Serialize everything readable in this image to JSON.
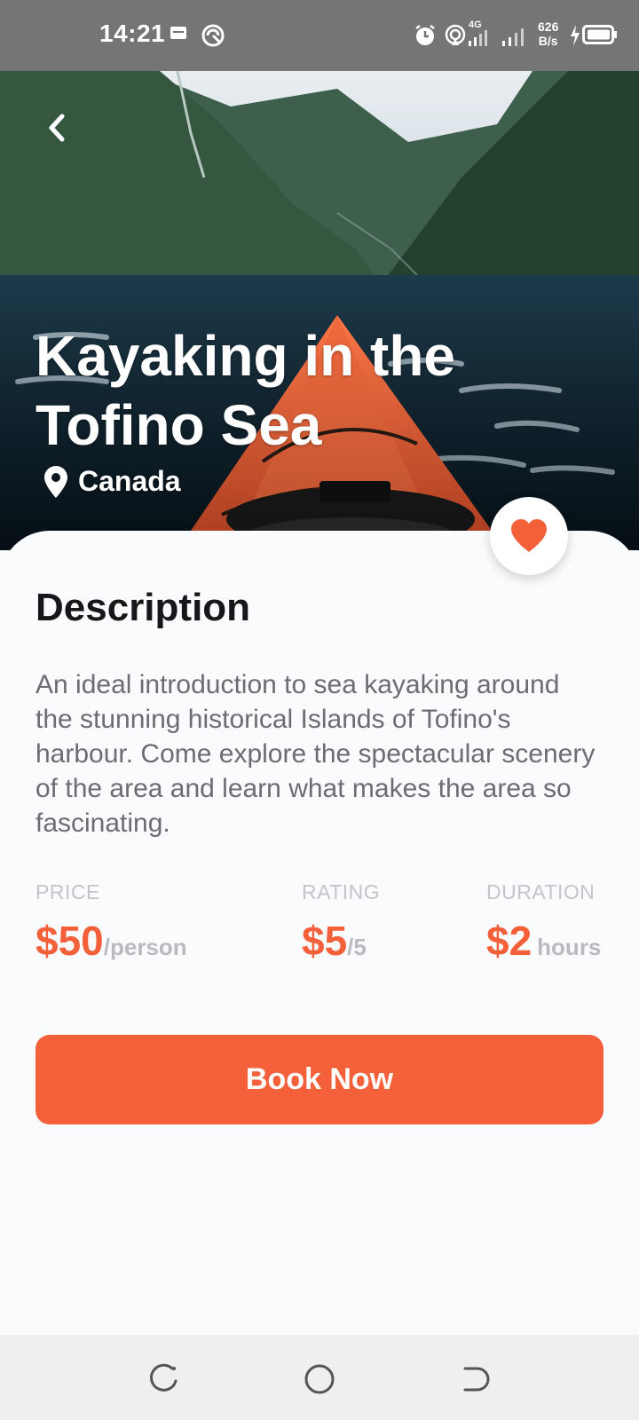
{
  "status_bar": {
    "time": "14:21",
    "network_speed_value": "626",
    "network_speed_unit": "B/s",
    "network_type": "4G",
    "icons": [
      "message-icon",
      "vpn-icon",
      "alarm-icon",
      "hotspot-icon",
      "signal-icon",
      "signal-icon",
      "charging-icon",
      "battery-icon"
    ]
  },
  "hero": {
    "title": "Kayaking in the Tofino Sea",
    "location": "Canada"
  },
  "content": {
    "description_heading": "Description",
    "description_text": "An ideal introduction to sea kayaking around the stunning historical Islands of Tofino's harbour. Come explore the spectacular scenery of the area and learn what makes the area so fascinating.",
    "stats": [
      {
        "label": "PRICE",
        "value": "$50",
        "unit": "/person"
      },
      {
        "label": "RATING",
        "value": "$5",
        "unit": "/5"
      },
      {
        "label": "DURATION",
        "value": "$2",
        "unit": "hours"
      }
    ],
    "book_button_label": "Book Now"
  },
  "colors": {
    "accent": "#f3603a",
    "status_bar": "#757575",
    "nav_bar": "#efefef",
    "background": "#fafbfd"
  }
}
